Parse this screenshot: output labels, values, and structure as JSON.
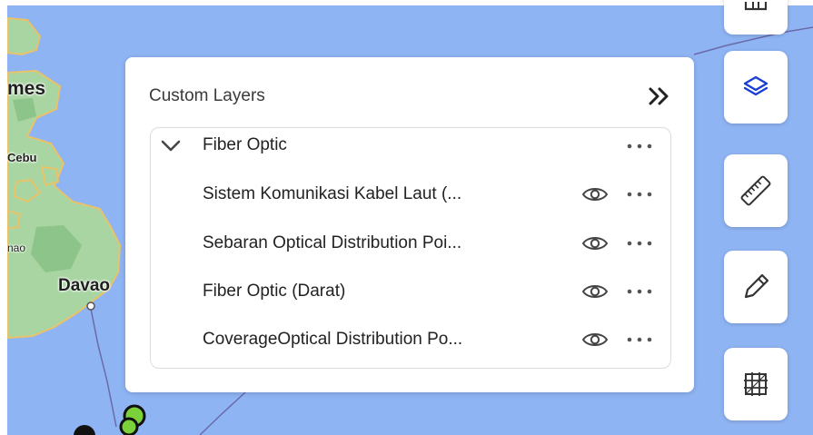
{
  "map": {
    "labels": {
      "mes": "mes",
      "cebu": "Cebu",
      "nao": "nao",
      "davao": "Davao"
    },
    "colors": {
      "water": "#8fb4f4",
      "land": "#a8d5a2",
      "coast": "#e9c36a",
      "route": "#6a6aa8"
    }
  },
  "panel": {
    "title": "Custom Layers",
    "collapse_icon": "double-chevron-right-icon",
    "group": {
      "label": "Fiber Optic",
      "expanded": true,
      "children": [
        {
          "label": "Sistem Komunikasi Kabel Laut (...",
          "visible": true
        },
        {
          "label": "Sebaran Optical Distribution Poi...",
          "visible": true
        },
        {
          "label": "Fiber Optic (Darat)",
          "visible": true
        },
        {
          "label": "CoverageOptical Distribution Po...",
          "visible": true
        }
      ]
    }
  },
  "toolbar": {
    "accent": "#1a3fd6",
    "tools": [
      {
        "name": "partial-tool",
        "icon": "partial-icon"
      },
      {
        "name": "layers-tool",
        "icon": "layers-icon",
        "active": true
      },
      {
        "name": "measure-tool",
        "icon": "ruler-icon"
      },
      {
        "name": "draw-tool",
        "icon": "pencil-icon"
      },
      {
        "name": "grid-tool",
        "icon": "grid-icon"
      }
    ]
  }
}
